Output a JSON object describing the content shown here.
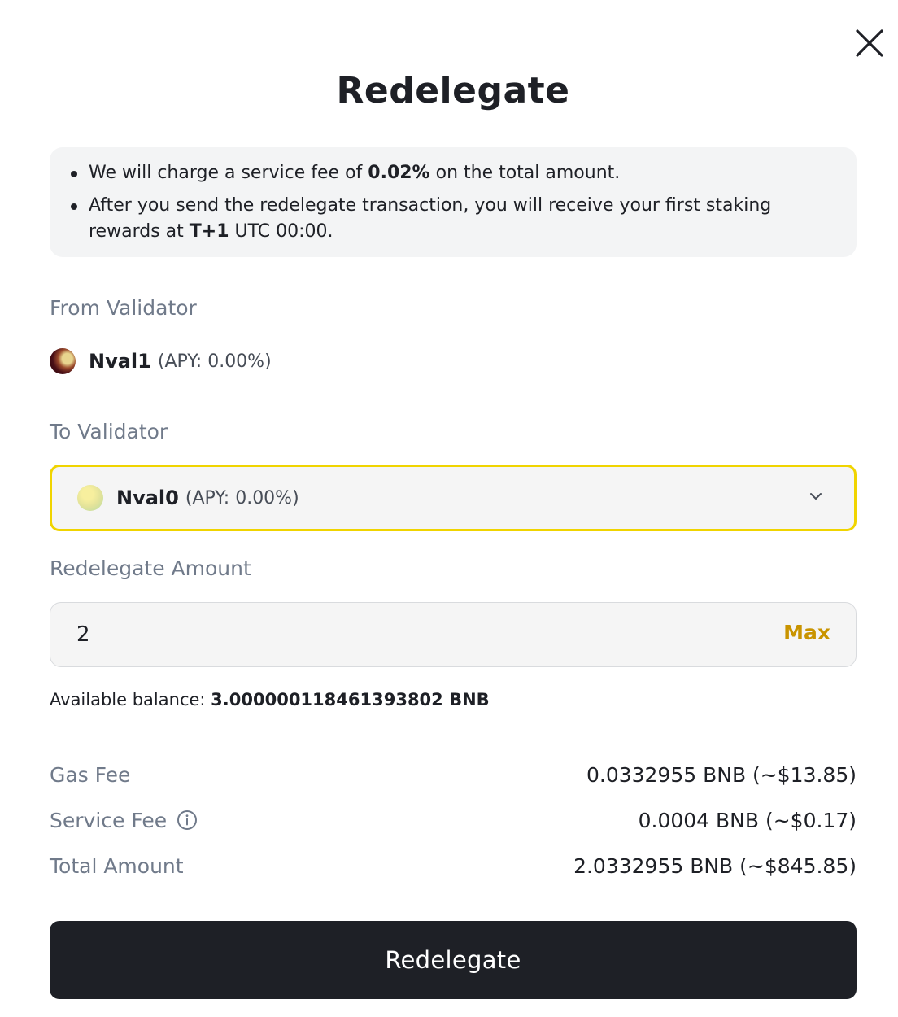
{
  "modal": {
    "title": "Redelegate"
  },
  "notice": {
    "item1_before": "We will charge a service fee of ",
    "item1_bold": "0.02%",
    "item1_after": " on the total amount.",
    "item2_before": "After you send the redelegate transaction, you will receive your first staking rewards at ",
    "item2_bold": "T+1",
    "item2_after": " UTC 00:00."
  },
  "from_validator": {
    "label": "From Validator",
    "name": "Nval1",
    "apy": "(APY: 0.00%)"
  },
  "to_validator": {
    "label": "To Validator",
    "selected_name": "Nval0",
    "selected_apy": "(APY: 0.00%)"
  },
  "amount": {
    "label": "Redelegate Amount",
    "value": "2",
    "max_label": "Max",
    "balance_label": "Available balance: ",
    "balance_value": "3.000000118461393802 BNB"
  },
  "fees": {
    "gas_label": "Gas Fee",
    "gas_value": "0.0332955 BNB (~$13.85)",
    "service_label": "Service Fee",
    "service_value": "0.0004 BNB (~$0.17)",
    "total_label": "Total Amount",
    "total_value": "2.0332955 BNB (~$845.85)"
  },
  "submit_label": "Redelegate",
  "colors": {
    "accent": "#f0d400",
    "max_text": "#c99400",
    "primary_dark": "#1e2026",
    "secondary_text": "#707a8a",
    "notice_bg": "#f3f4f5"
  },
  "icons": {
    "close": "close-icon",
    "chevron": "chevron-down-icon",
    "info": "info-icon"
  }
}
